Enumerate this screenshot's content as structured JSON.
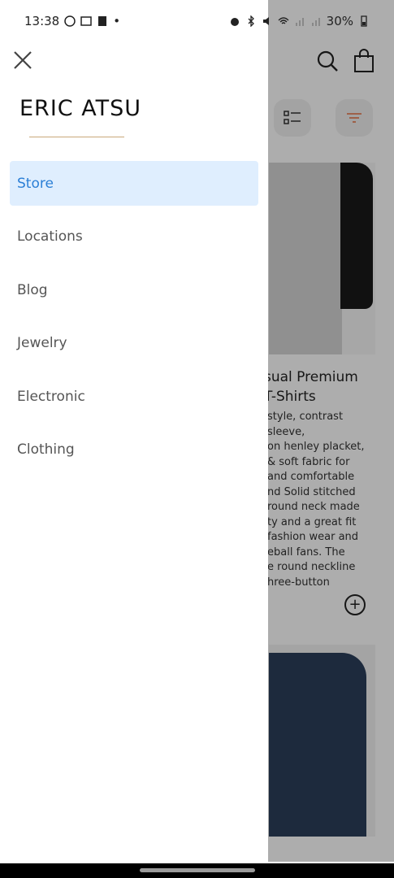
{
  "status_bar": {
    "time": "13:38",
    "battery": "30%"
  },
  "drawer": {
    "brand": "ERIC ATSU",
    "menu": [
      {
        "label": "Store",
        "active": true
      },
      {
        "label": "Locations",
        "active": false
      },
      {
        "label": "Blog",
        "active": false
      },
      {
        "label": "Jewelry",
        "active": false
      },
      {
        "label": "Electronic",
        "active": false
      },
      {
        "label": "Clothing",
        "active": false
      }
    ]
  },
  "background": {
    "product": {
      "title": "sual Premium\nT-Shirts",
      "description": "style, contrast\nsleeve,\non henley placket,\n& soft fabric for\nand comfortable\nnd Solid stitched\nround neck made\nty and a great fit\nfashion wear and\neball fans. The\ne round neckline\nhree-button"
    }
  },
  "colors": {
    "accent": "#2b7fd6",
    "active_bg": "#dfeefe",
    "divider": "#c9a77a"
  }
}
